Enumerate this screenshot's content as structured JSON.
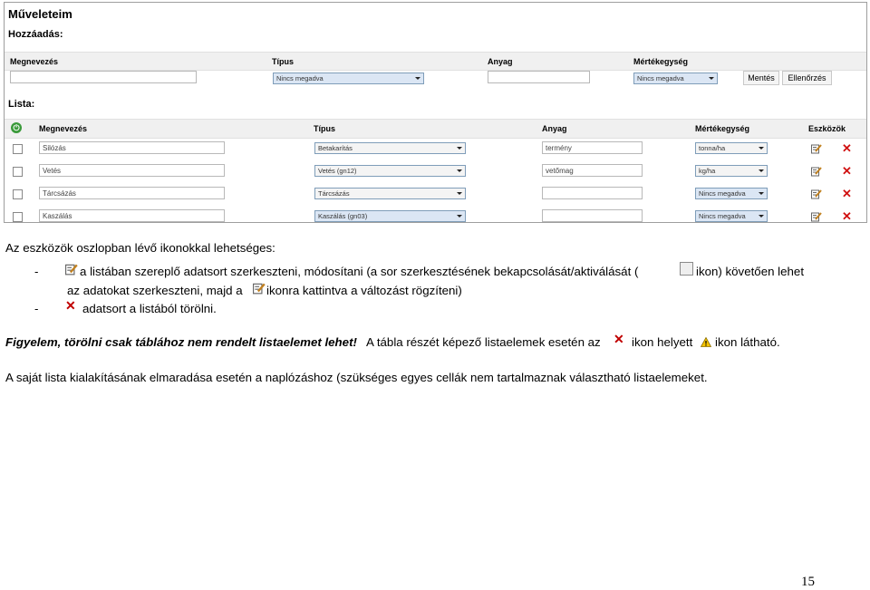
{
  "screenshot": {
    "title": "Műveleteim",
    "add_section": "Hozzáadás:",
    "list_section": "Lista:",
    "add_headers": [
      "Megnevezés",
      "Típus",
      "Anyag",
      "Mértékegység"
    ],
    "add_type_select": "Nincs megadva",
    "add_unit_select": "Nincs megadva",
    "save_button": "Mentés",
    "check_button": "Ellenőrzés",
    "list_headers": [
      "Megnevezés",
      "Típus",
      "Anyag",
      "Mértékegység",
      "Eszközök"
    ],
    "rows": [
      {
        "name": "Silózás",
        "type": "Betakarítás",
        "material": "termény",
        "unit": "tonna/ha"
      },
      {
        "name": "Vetés",
        "type": "Vetés (gn12)",
        "material": "vetőmag",
        "unit": "kg/ha"
      },
      {
        "name": "Tárcsázás",
        "type": "Tárcsázás",
        "material": "",
        "unit": "Nincs megadva"
      },
      {
        "name": "Kaszálás",
        "type": "Kaszálás (gn03)",
        "material": "",
        "unit": "Nincs megadva"
      }
    ]
  },
  "doc": {
    "intro": "Az eszközök oszlopban lévő ikonokkal lehetséges:",
    "bullet1_dash": "-",
    "bullet1_a": "a listában szereplő adatsort szerkeszteni, módosítani (a sor szerkesztésének bekapcsolását/aktiválását (",
    "bullet1_b": "ikon) követően lehet",
    "bullet1_c": "az adatokat szerkeszteni, majd a",
    "bullet1_d": "ikonra kattintva a változást rögzíteni)",
    "bullet2_dash": "-",
    "bullet2": "adatsort a listából törölni.",
    "warning_bold": "Figyelem, törölni csak táblához nem rendelt listaelemet lehet!",
    "warning_a": "A tábla részét képező listaelemek esetén az",
    "warning_b": "ikon helyett",
    "warning_c": "ikon látható.",
    "closing": "A saját lista kialakításának elmaradása esetén a naplózáshoz (szükséges egyes cellák nem tartalmaznak választható listaelemeket.",
    "page_number": "15"
  },
  "colors": {
    "delete_icon": "#d01010",
    "power_icon": "#3a9a3a",
    "select_blue": "#dbe6f4"
  }
}
